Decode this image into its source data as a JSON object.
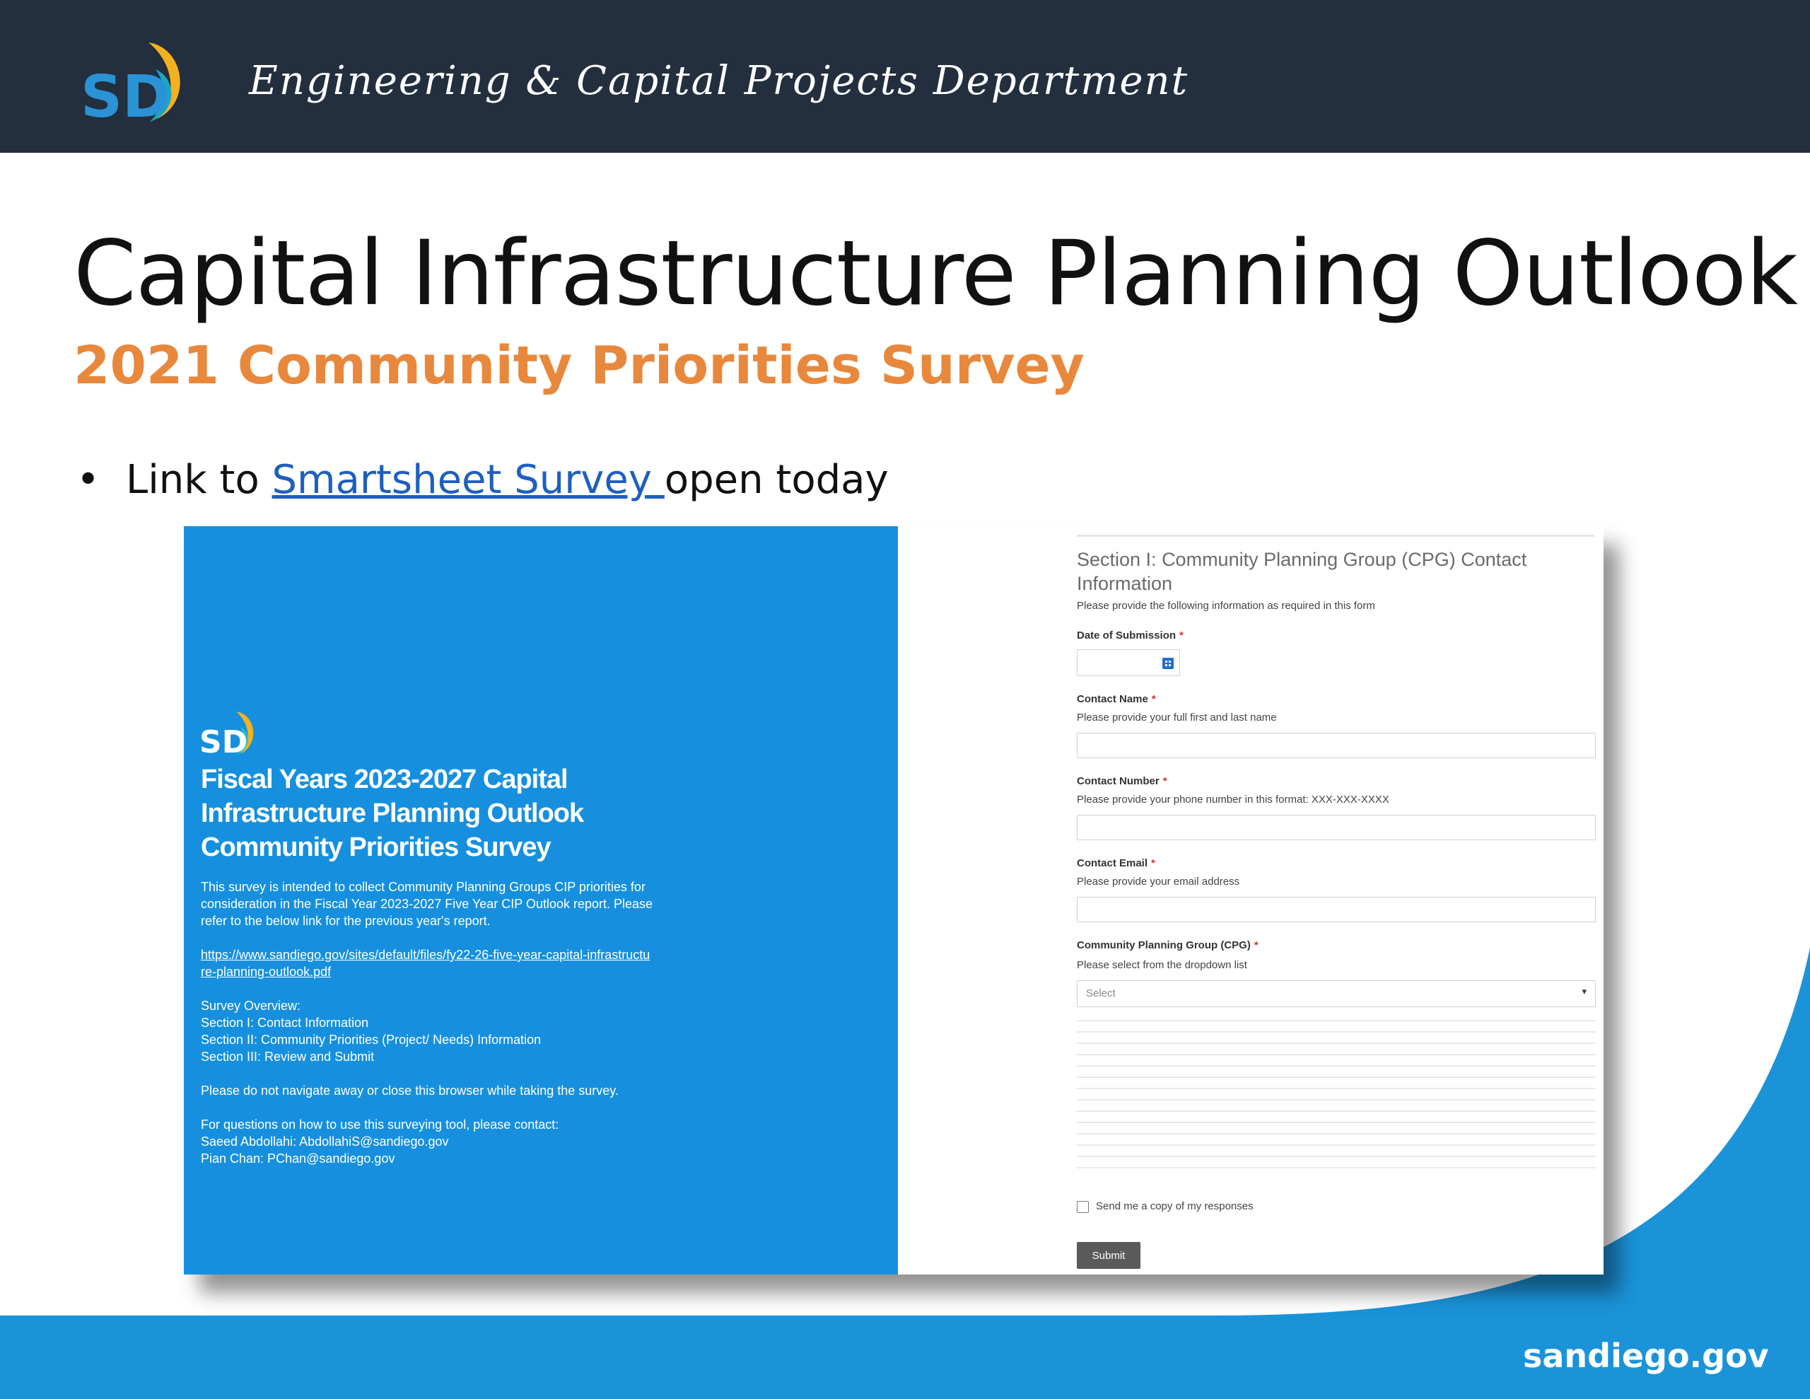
{
  "header": {
    "logo_text": "SD",
    "department": "Engineering & Capital Projects Department"
  },
  "slide": {
    "title": "Capital Infrastructure Planning Outlook",
    "subtitle": "2021 Community Priorities Survey",
    "bullet_prefix": "Link to ",
    "bullet_link": "Smartsheet Survey ",
    "bullet_suffix": "open today"
  },
  "survey_intro": {
    "title_lines": [
      "Fiscal Years 2023-2027 Capital",
      "Infrastructure Planning Outlook",
      "Community Priorities Survey"
    ],
    "description_lines": [
      "This survey is intended to collect Community Planning Groups CIP priorities for",
      "consideration in the Fiscal Year 2023-2027 Five Year CIP Outlook report. Please",
      "refer to the below link for the previous year's report."
    ],
    "link_lines": [
      "https://www.sandiego.gov/sites/default/files/fy22-26-five-year-capital-infrastructu",
      "re-planning-outlook.pdf"
    ],
    "overview_lines": [
      "Survey Overview:",
      "Section I: Contact Information",
      "Section II: Community Priorities (Project/ Needs) Information",
      "Section III: Review and Submit"
    ],
    "warning": "Please do not navigate away or close this browser while taking the survey.",
    "contact_lines": [
      "For questions on how to use this surveying tool, please contact:",
      "Saeed Abdollahi: AbdollahiS@sandiego.gov",
      "Pian Chan: PChan@sandiego.gov"
    ]
  },
  "form": {
    "section_title": "Section I: Community Planning Group (CPG) Contact Information",
    "section_desc": "Please provide the following information as required in this form",
    "required_mark": "*",
    "date_label": "Date of Submission",
    "name_label": "Contact Name",
    "name_help": "Please provide your full first and last name",
    "phone_label": "Contact Number",
    "phone_help": "Please provide your phone number in this format: XXX-XXX-XXXX",
    "email_label": "Contact Email",
    "email_help": "Please provide your email address",
    "cpg_label": "Community Planning Group (CPG)",
    "cpg_help": "Please select from the dropdown list",
    "cpg_select_value": "Select",
    "copy_label": "Send me a copy of my responses",
    "submit_label": "Submit"
  },
  "footer": {
    "site": "sandiego.gov"
  },
  "colors": {
    "header_bg": "#232f3e",
    "subtitle_orange": "#e8883c",
    "link_blue": "#1f5fbf",
    "survey_blue": "#1690de",
    "footer_blue": "#1b93d9",
    "required_red": "#d9312b",
    "submit_gray": "#5a5a5a"
  }
}
